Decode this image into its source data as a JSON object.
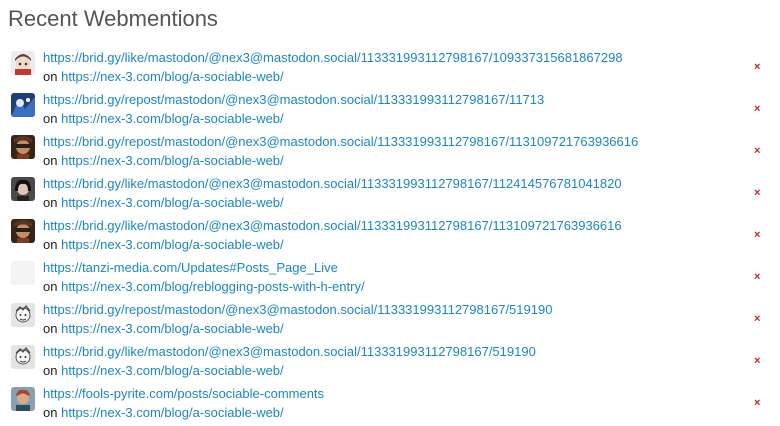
{
  "title": "Recent Webmentions",
  "on_label": "on",
  "delete_label": "×",
  "mentions": [
    {
      "source": "https://brid.gy/like/mastodon/@nex3@mastodon.social/113331993112798167/109337315681867298",
      "target": "https://nex-3.com/blog/a-sociable-web/",
      "avatar": "avatar-anime"
    },
    {
      "source": "https://brid.gy/repost/mastodon/@nex3@mastodon.social/113331993112798167/11713",
      "target": "https://nex-3.com/blog/a-sociable-web/",
      "avatar": "avatar-blue"
    },
    {
      "source": "https://brid.gy/repost/mastodon/@nex3@mastodon.social/113331993112798167/113109721763936616",
      "target": "https://nex-3.com/blog/a-sociable-web/",
      "avatar": "avatar-masked"
    },
    {
      "source": "https://brid.gy/like/mastodon/@nex3@mastodon.social/113331993112798167/112414576781041820",
      "target": "https://nex-3.com/blog/a-sociable-web/",
      "avatar": "avatar-dark"
    },
    {
      "source": "https://brid.gy/like/mastodon/@nex3@mastodon.social/113331993112798167/113109721763936616",
      "target": "https://nex-3.com/blog/a-sociable-web/",
      "avatar": "avatar-masked"
    },
    {
      "source": "https://tanzi-media.com/Updates#Posts_Page_Live",
      "target": "https://nex-3.com/blog/reblogging-posts-with-h-entry/",
      "avatar": "avatar-blank"
    },
    {
      "source": "https://brid.gy/repost/mastodon/@nex3@mastodon.social/113331993112798167/519190",
      "target": "https://nex-3.com/blog/a-sociable-web/",
      "avatar": "avatar-sketch"
    },
    {
      "source": "https://brid.gy/like/mastodon/@nex3@mastodon.social/113331993112798167/519190",
      "target": "https://nex-3.com/blog/a-sociable-web/",
      "avatar": "avatar-sketch"
    },
    {
      "source": "https://fools-pyrite.com/posts/sociable-comments",
      "target": "https://nex-3.com/blog/a-sociable-web/",
      "avatar": "avatar-portrait"
    }
  ]
}
